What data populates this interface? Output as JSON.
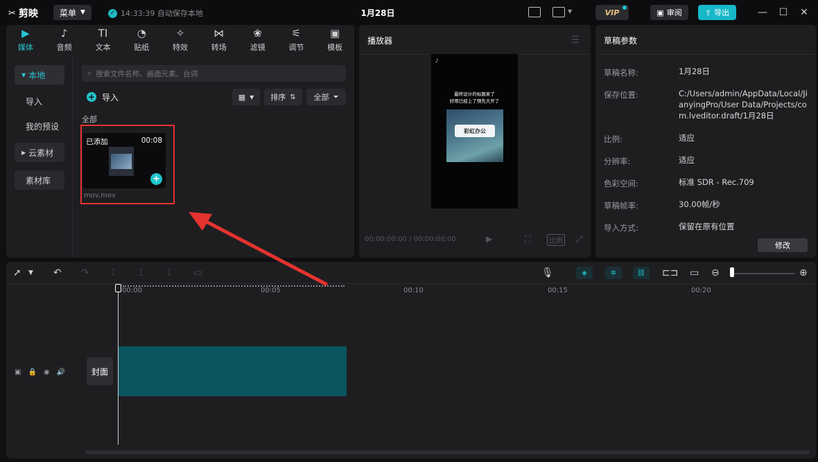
{
  "app": {
    "name": "剪映",
    "menu_label": "菜单",
    "autosave_text": "14:33:39 自动保存本地",
    "doc_title": "1月28日",
    "vip_label": "VIP",
    "review_label": "审阅",
    "export_label": "导出"
  },
  "media_tabs": [
    {
      "label": "媒体",
      "icon": "play-square-icon",
      "glyph": "▶"
    },
    {
      "label": "音频",
      "icon": "music-note-icon",
      "glyph": "♪"
    },
    {
      "label": "文本",
      "icon": "text-icon",
      "glyph": "TI"
    },
    {
      "label": "贴纸",
      "icon": "sticker-icon",
      "glyph": "◔"
    },
    {
      "label": "特效",
      "icon": "sparkle-icon",
      "glyph": "✧"
    },
    {
      "label": "转场",
      "icon": "bowtie-icon",
      "glyph": "⋈"
    },
    {
      "label": "滤镜",
      "icon": "filter-circles-icon",
      "glyph": "❀"
    },
    {
      "label": "调节",
      "icon": "sliders-icon",
      "glyph": "⚟"
    },
    {
      "label": "模板",
      "icon": "template-icon",
      "glyph": "▣"
    }
  ],
  "media_side": {
    "local": "本地",
    "import": "导入",
    "my_presets": "我的预设",
    "cloud": "云素材",
    "library": "素材库"
  },
  "media": {
    "search_placeholder": "搜索文件名称、画面元素、台词",
    "import_label": "导入",
    "sort_label": "排序",
    "all_label": "全部",
    "section_label": "全部",
    "clip": {
      "added_label": "已添加",
      "duration": "00:08",
      "filename": "mov.mov"
    }
  },
  "player": {
    "title": "播放器",
    "timecode_current": "00:00:00:00",
    "timecode_total": "00:00:08:00",
    "ratio_label": "比例",
    "video_caption_line1": "最终设计的标题来了",
    "video_caption_line2": "好用已经上了预先大开了",
    "video_badge": "彩虹办公"
  },
  "draft": {
    "title": "草稿参数",
    "rows": [
      {
        "label": "草稿名称:",
        "value": "1月28日"
      },
      {
        "label": "保存位置:",
        "value": "C:/Users/admin/AppData/Local/JianyingPro/User Data/Projects/com.lveditor.draft/1月28日"
      },
      {
        "label": "比例:",
        "value": "适应"
      },
      {
        "label": "分辨率:",
        "value": "适应"
      },
      {
        "label": "色彩空间:",
        "value": "标准 SDR - Rec.709"
      },
      {
        "label": "草稿帧率:",
        "value": "30.00帧/秒"
      },
      {
        "label": "导入方式:",
        "value": "保留在原有位置"
      }
    ],
    "modify_label": "修改"
  },
  "timeline": {
    "ruler": [
      "00:00",
      "00:05",
      "00:10",
      "00:15",
      "00:20"
    ],
    "cover_label": "封面"
  },
  "colors": {
    "accent": "#20c4cc",
    "clip": "#0a5560",
    "highlight": "#e5332f"
  }
}
